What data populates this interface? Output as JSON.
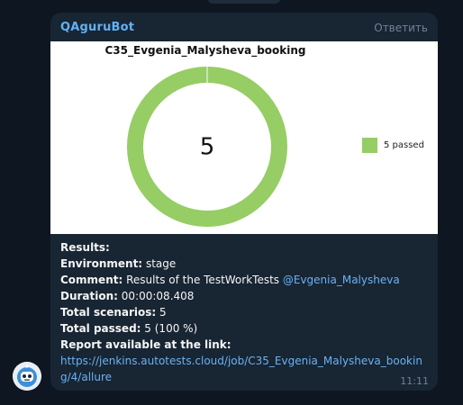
{
  "message": {
    "sender": "QAguruBot",
    "reply_label": "Ответить",
    "time": "11:11",
    "results_label": "Results:",
    "environment_label": "Environment:",
    "environment_value": "stage",
    "comment_label": "Comment:",
    "comment_value": "Results of the TestWorkTests",
    "comment_mention": "@Evgenia_Malysheva",
    "duration_label": "Duration:",
    "duration_value": "00:00:08.408",
    "total_scenarios_label": "Total scenarios:",
    "total_scenarios_value": "5",
    "total_passed_label": "Total passed:",
    "total_passed_value": "5 (100 %)",
    "report_label": "Report available at the link:",
    "report_url_line1": "https://jenkins.autotests.cloud/job/C35_Evgenia_Malysheva_bookin",
    "report_url_line2": "g/4/allure"
  },
  "chart_data": {
    "type": "pie",
    "title": "C35_Evgenia_Malysheva_booking",
    "center_label": "5",
    "slices": [
      {
        "label": "5 passed",
        "value": 5,
        "color": "#96cd64"
      }
    ]
  },
  "colors": {
    "background": "#0e1621",
    "bubble": "#182533",
    "sender": "#61b1f5",
    "link": "#6ab2f2",
    "passed": "#96cd64"
  }
}
